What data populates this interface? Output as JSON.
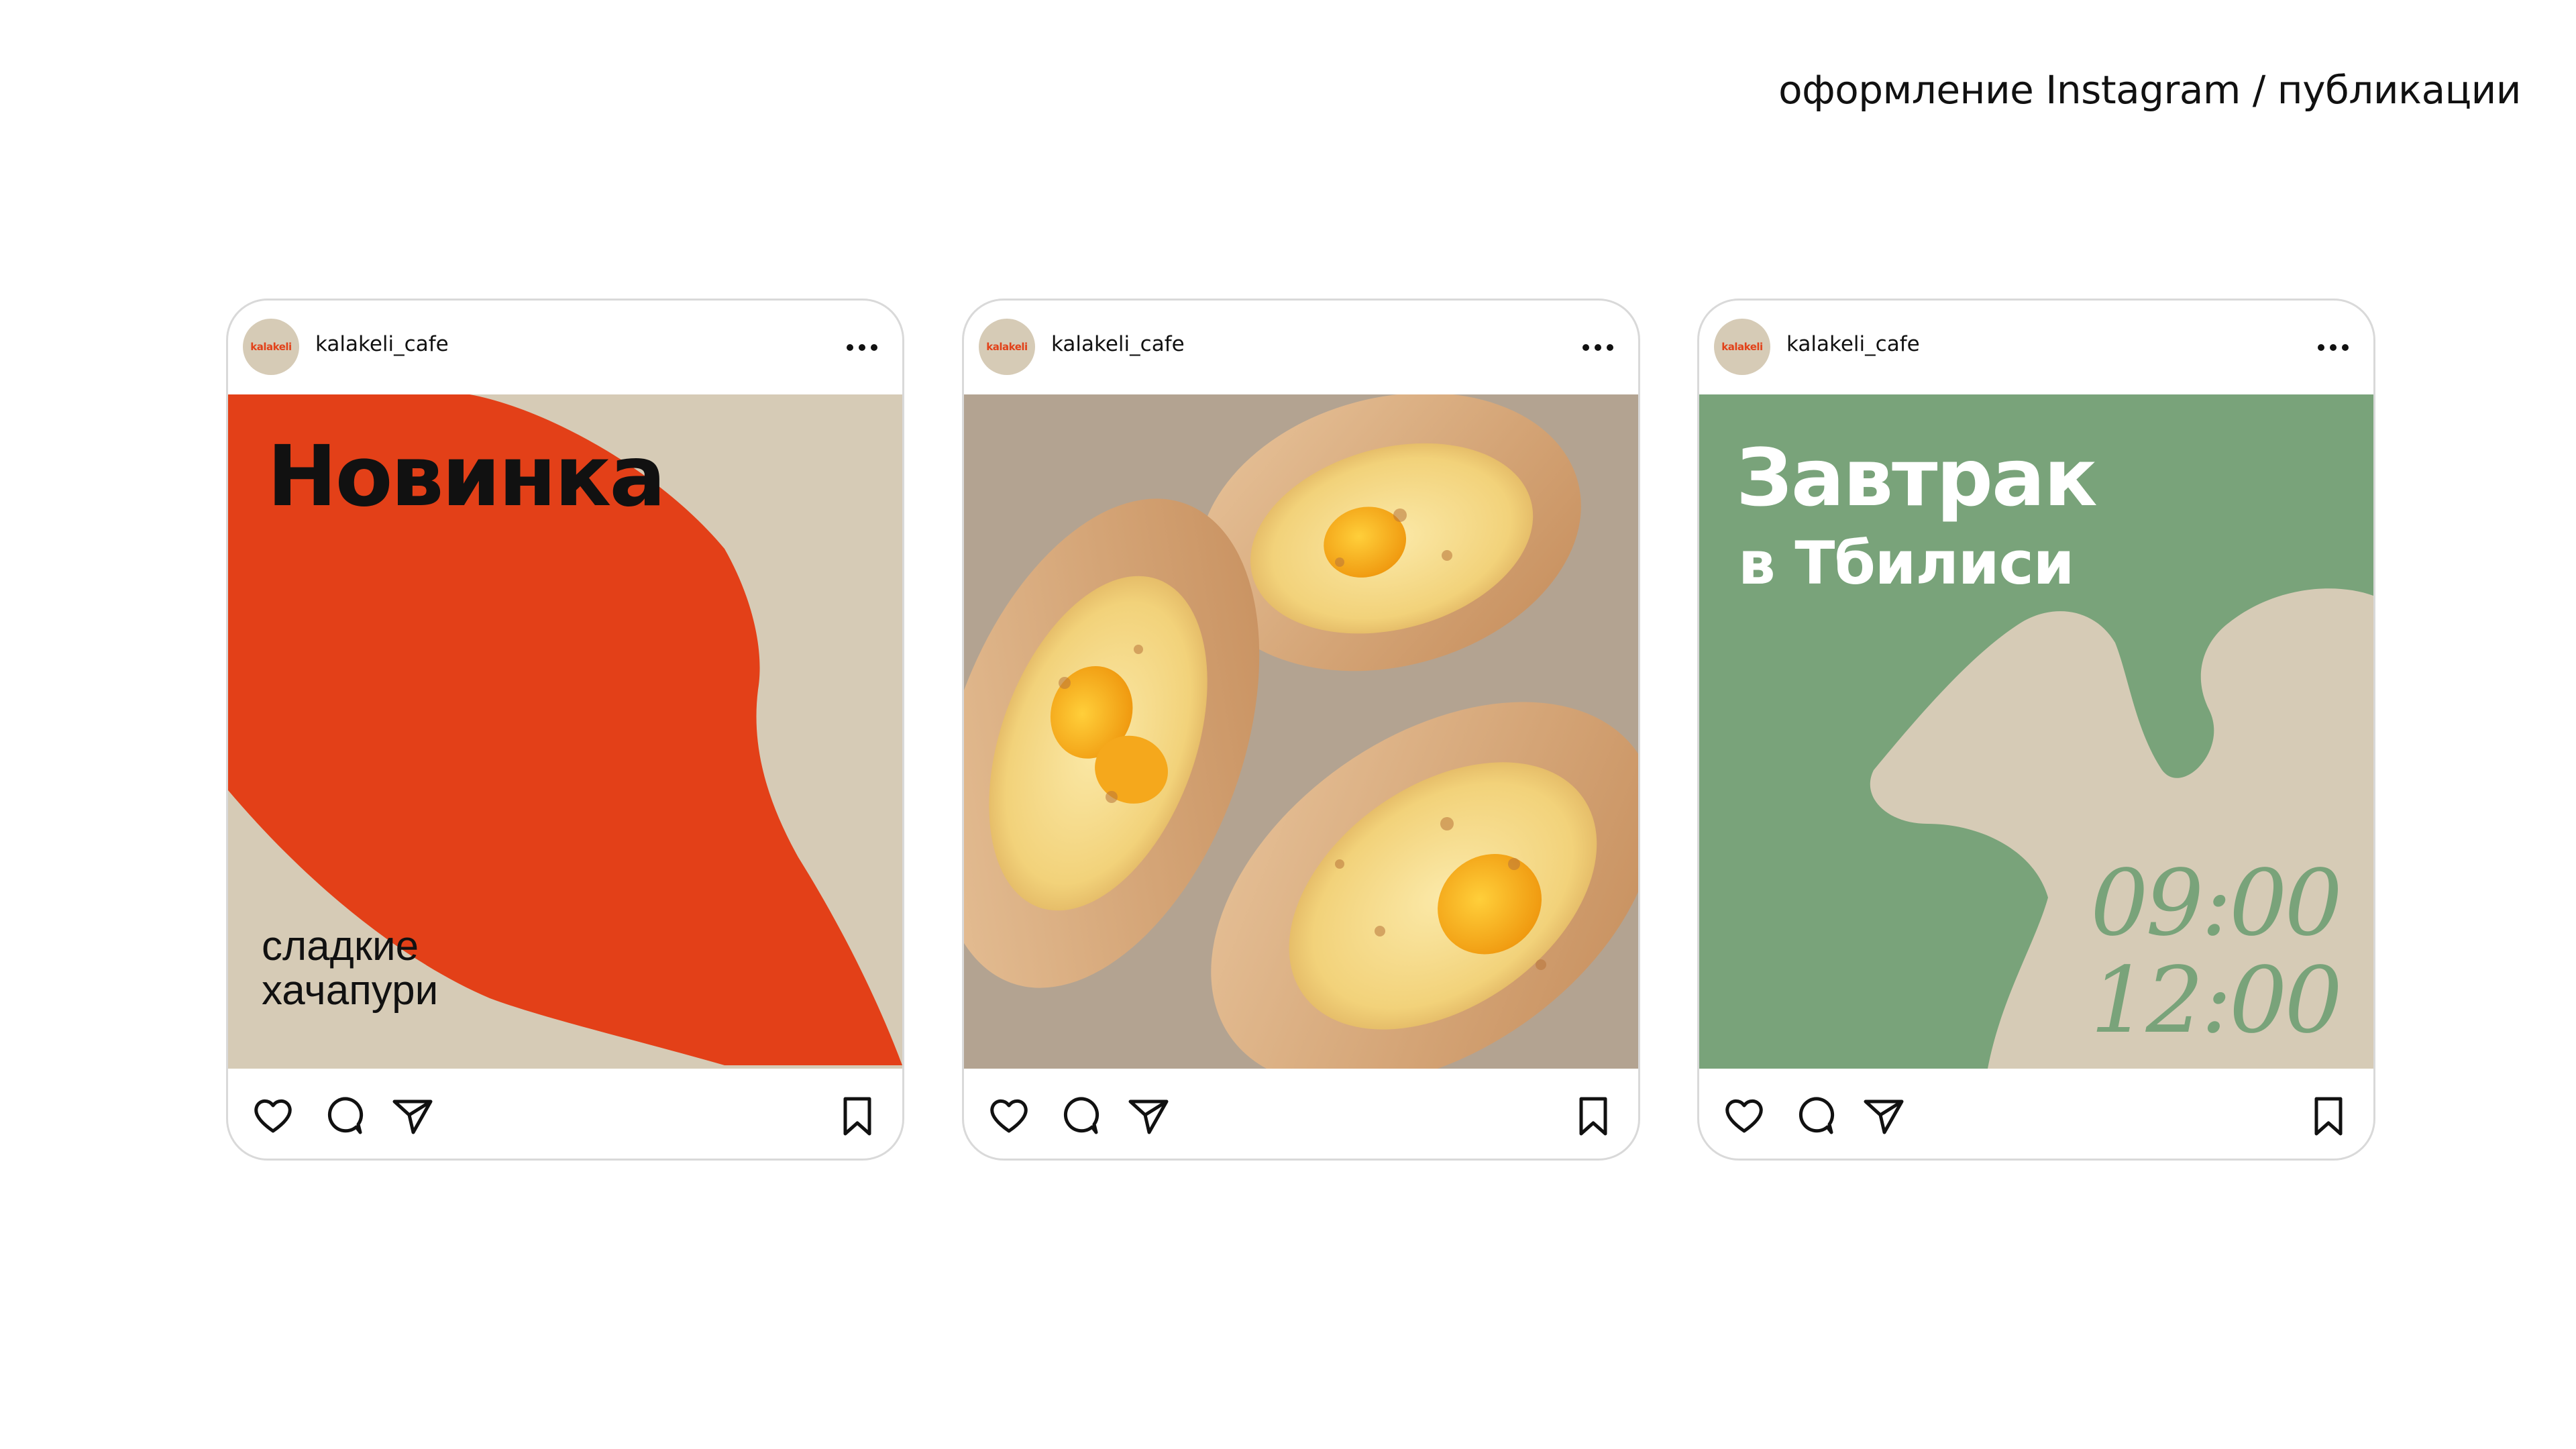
{
  "page": {
    "title": "оформление Instagram / публикации"
  },
  "colors": {
    "accent_red": "#e34018",
    "beige": "#d6cbb6",
    "green": "#79a37a",
    "text_dark": "#111111"
  },
  "posts": [
    {
      "username": "kalakeli_cafe",
      "avatar_text": "kalakeli",
      "headline": "Новинка",
      "subtitle": "сладкие\nхачапури",
      "icons": [
        "heart-icon",
        "comment-icon",
        "send-icon",
        "bookmark-icon",
        "more-icon"
      ]
    },
    {
      "username": "kalakeli_cafe",
      "avatar_text": "kalakeli",
      "image": "photo of adjarian khachapuri with eggs",
      "icons": [
        "heart-icon",
        "comment-icon",
        "send-icon",
        "bookmark-icon",
        "more-icon"
      ]
    },
    {
      "username": "kalakeli_cafe",
      "avatar_text": "kalakeli",
      "headline": "Завтрак",
      "headline_line2": "в Тбилиси",
      "time_start": "09:00",
      "time_end": "12:00",
      "icons": [
        "heart-icon",
        "comment-icon",
        "send-icon",
        "bookmark-icon",
        "more-icon"
      ]
    }
  ]
}
